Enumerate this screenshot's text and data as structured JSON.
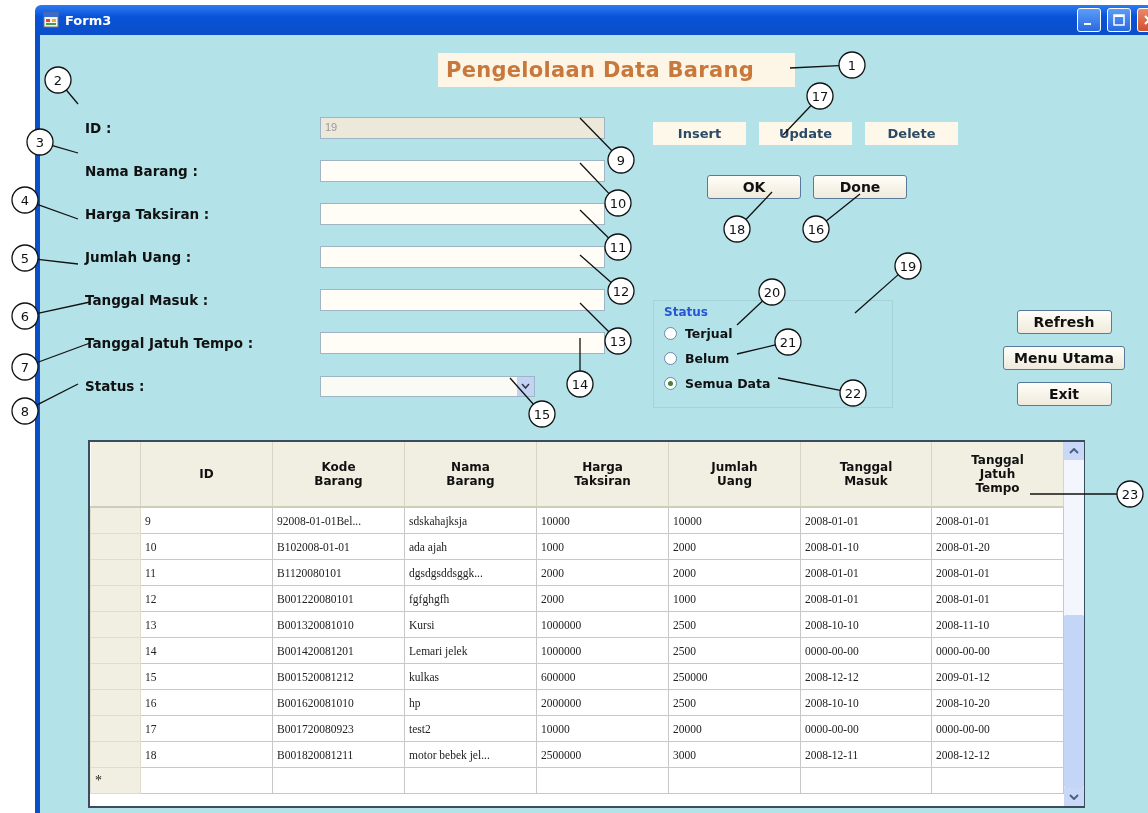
{
  "window": {
    "title": "Form3"
  },
  "heading": "Pengelolaan Data Barang",
  "fields": [
    {
      "label": "ID :",
      "value": "19",
      "disabled": true
    },
    {
      "label": "Nama Barang :",
      "disabled": false
    },
    {
      "label": "Harga Taksiran :",
      "disabled": false
    },
    {
      "label": "Jumlah Uang :",
      "disabled": false
    },
    {
      "label": "Tanggal Masuk :",
      "disabled": false
    },
    {
      "label": "Tanggal Jatuh Tempo :",
      "disabled": false
    }
  ],
  "status_field": {
    "label": "Status :"
  },
  "action_buttons": [
    "Insert",
    "Update",
    "Delete"
  ],
  "confirm_buttons": [
    "OK",
    "Done"
  ],
  "status_group": {
    "title": "Status",
    "options": [
      {
        "label": "Terjual",
        "selected": false
      },
      {
        "label": "Belum",
        "selected": false
      },
      {
        "label": "Semua Data",
        "selected": true
      }
    ]
  },
  "nav_buttons": [
    "Refresh",
    "Menu Utama",
    "Exit"
  ],
  "table": {
    "columns": [
      "ID",
      "Kode Barang",
      "Nama Barang",
      "Harga Taksiran",
      "Jumlah Uang",
      "Tanggal Masuk",
      "Tanggal Jatuh Tempo"
    ],
    "rows": [
      [
        "9",
        "92008-01-01Bel...",
        "sdskahajksja",
        "10000",
        "10000",
        "2008-01-01",
        "2008-01-01"
      ],
      [
        "10",
        "B102008-01-01",
        "ada ajah",
        "1000",
        "2000",
        "2008-01-10",
        "2008-01-20"
      ],
      [
        "11",
        "B1120080101",
        "dgsdgsddsggk...",
        "2000",
        "2000",
        "2008-01-01",
        "2008-01-01"
      ],
      [
        "12",
        "B001220080101",
        "fgfghgfh",
        "2000",
        "1000",
        "2008-01-01",
        "2008-01-01"
      ],
      [
        "13",
        "B001320081010",
        "Kursi",
        "1000000",
        "2500",
        "2008-10-10",
        "2008-11-10"
      ],
      [
        "14",
        "B001420081201",
        "Lemari jelek",
        "1000000",
        "2500",
        "0000-00-00",
        "0000-00-00"
      ],
      [
        "15",
        "B001520081212",
        "kulkas",
        "600000",
        "250000",
        "2008-12-12",
        "2009-01-12"
      ],
      [
        "16",
        "B001620081010",
        "hp",
        "2000000",
        "2500",
        "2008-10-10",
        "2008-10-20"
      ],
      [
        "17",
        "B001720080923",
        "test2",
        "10000",
        "20000",
        "0000-00-00",
        "0000-00-00"
      ],
      [
        "18",
        "B001820081211",
        "motor bebek jel...",
        "2500000",
        "3000",
        "2008-12-11",
        "2008-12-12"
      ]
    ],
    "new_row_marker": "*"
  },
  "callouts": [
    "1",
    "2",
    "3",
    "4",
    "5",
    "6",
    "7",
    "8",
    "9",
    "10",
    "11",
    "12",
    "13",
    "14",
    "15",
    "16",
    "17",
    "18",
    "19",
    "20",
    "21",
    "22",
    "23"
  ]
}
